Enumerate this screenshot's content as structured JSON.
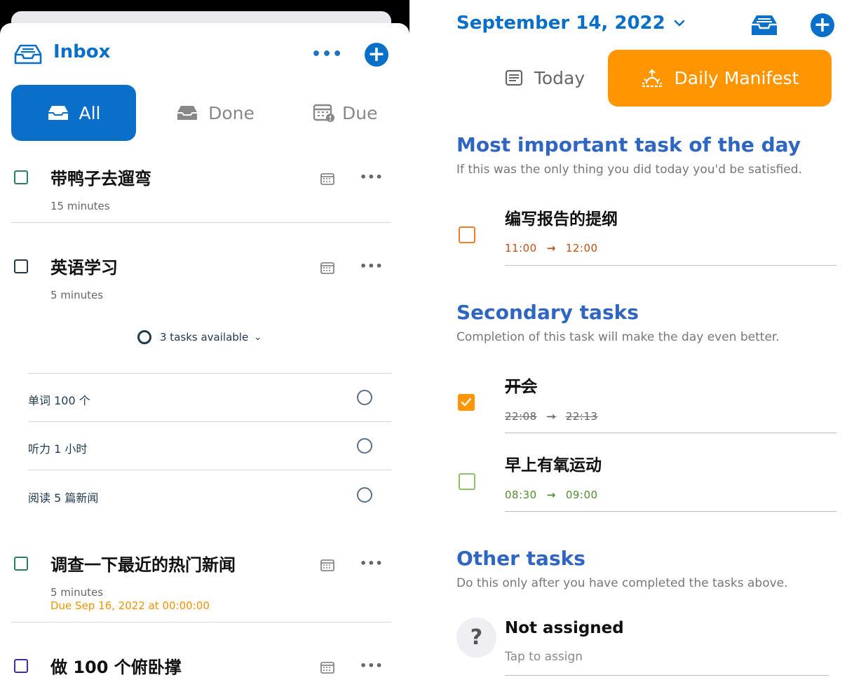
{
  "inbox": {
    "title": "Inbox",
    "more_label": "•••",
    "add_label": "+",
    "filters": [
      {
        "label": "All",
        "icon": "inbox-icon"
      },
      {
        "label": "Done",
        "icon": "tray-icon"
      },
      {
        "label": "Due",
        "icon": "calendar-alert-icon"
      }
    ],
    "tasks": [
      {
        "title": "带鸭子去遛弯",
        "duration": "15 minutes"
      },
      {
        "title": "英语学习",
        "duration": "5 minutes"
      },
      {
        "title": "调查一下最近的热门新闻",
        "duration": "5 minutes",
        "due": "Due Sep 16, 2022 at 00:00:00"
      },
      {
        "title": "做 100 个俯卧撑"
      }
    ],
    "subtasks_toggle": "3 tasks available",
    "subtasks": [
      "单词 100 个",
      "听力 1 小时",
      "阅读 5 篇新闻"
    ],
    "colors": {
      "accent": "#0a6fc8",
      "due": "#f39200"
    }
  },
  "manifest": {
    "date": "September 14, 2022",
    "add_label": "+",
    "tabs": [
      {
        "label": "Today",
        "icon": "document-icon"
      },
      {
        "label": "Daily Manifest",
        "icon": "sunrise-icon",
        "active": true
      }
    ],
    "sections": {
      "important": {
        "title": "Most important task of the day",
        "subtitle": "If this was the only thing you did today you'd be satisfied.",
        "tasks": [
          {
            "title": "编写报告的提纲",
            "start": "11:00",
            "end": "12:00"
          }
        ]
      },
      "secondary": {
        "title": "Secondary tasks",
        "subtitle": "Completion of this task will make the day even better.",
        "tasks": [
          {
            "title": "开会",
            "start": "22:08",
            "end": "22:13",
            "done": true
          },
          {
            "title": "早上有氧运动",
            "start": "08:30",
            "end": "09:00"
          }
        ]
      },
      "other": {
        "title": "Other tasks",
        "subtitle": "Do this only after you have completed the tasks above.",
        "item": {
          "title": "Not assigned",
          "hint": "Tap to assign",
          "icon": "question-icon",
          "glyph": "?"
        }
      }
    },
    "arrow": "→",
    "colors": {
      "orange": "#ff9500",
      "green": "#5a9e32",
      "red_orange": "#c24d12",
      "section_blue": "#2f66c2"
    }
  }
}
